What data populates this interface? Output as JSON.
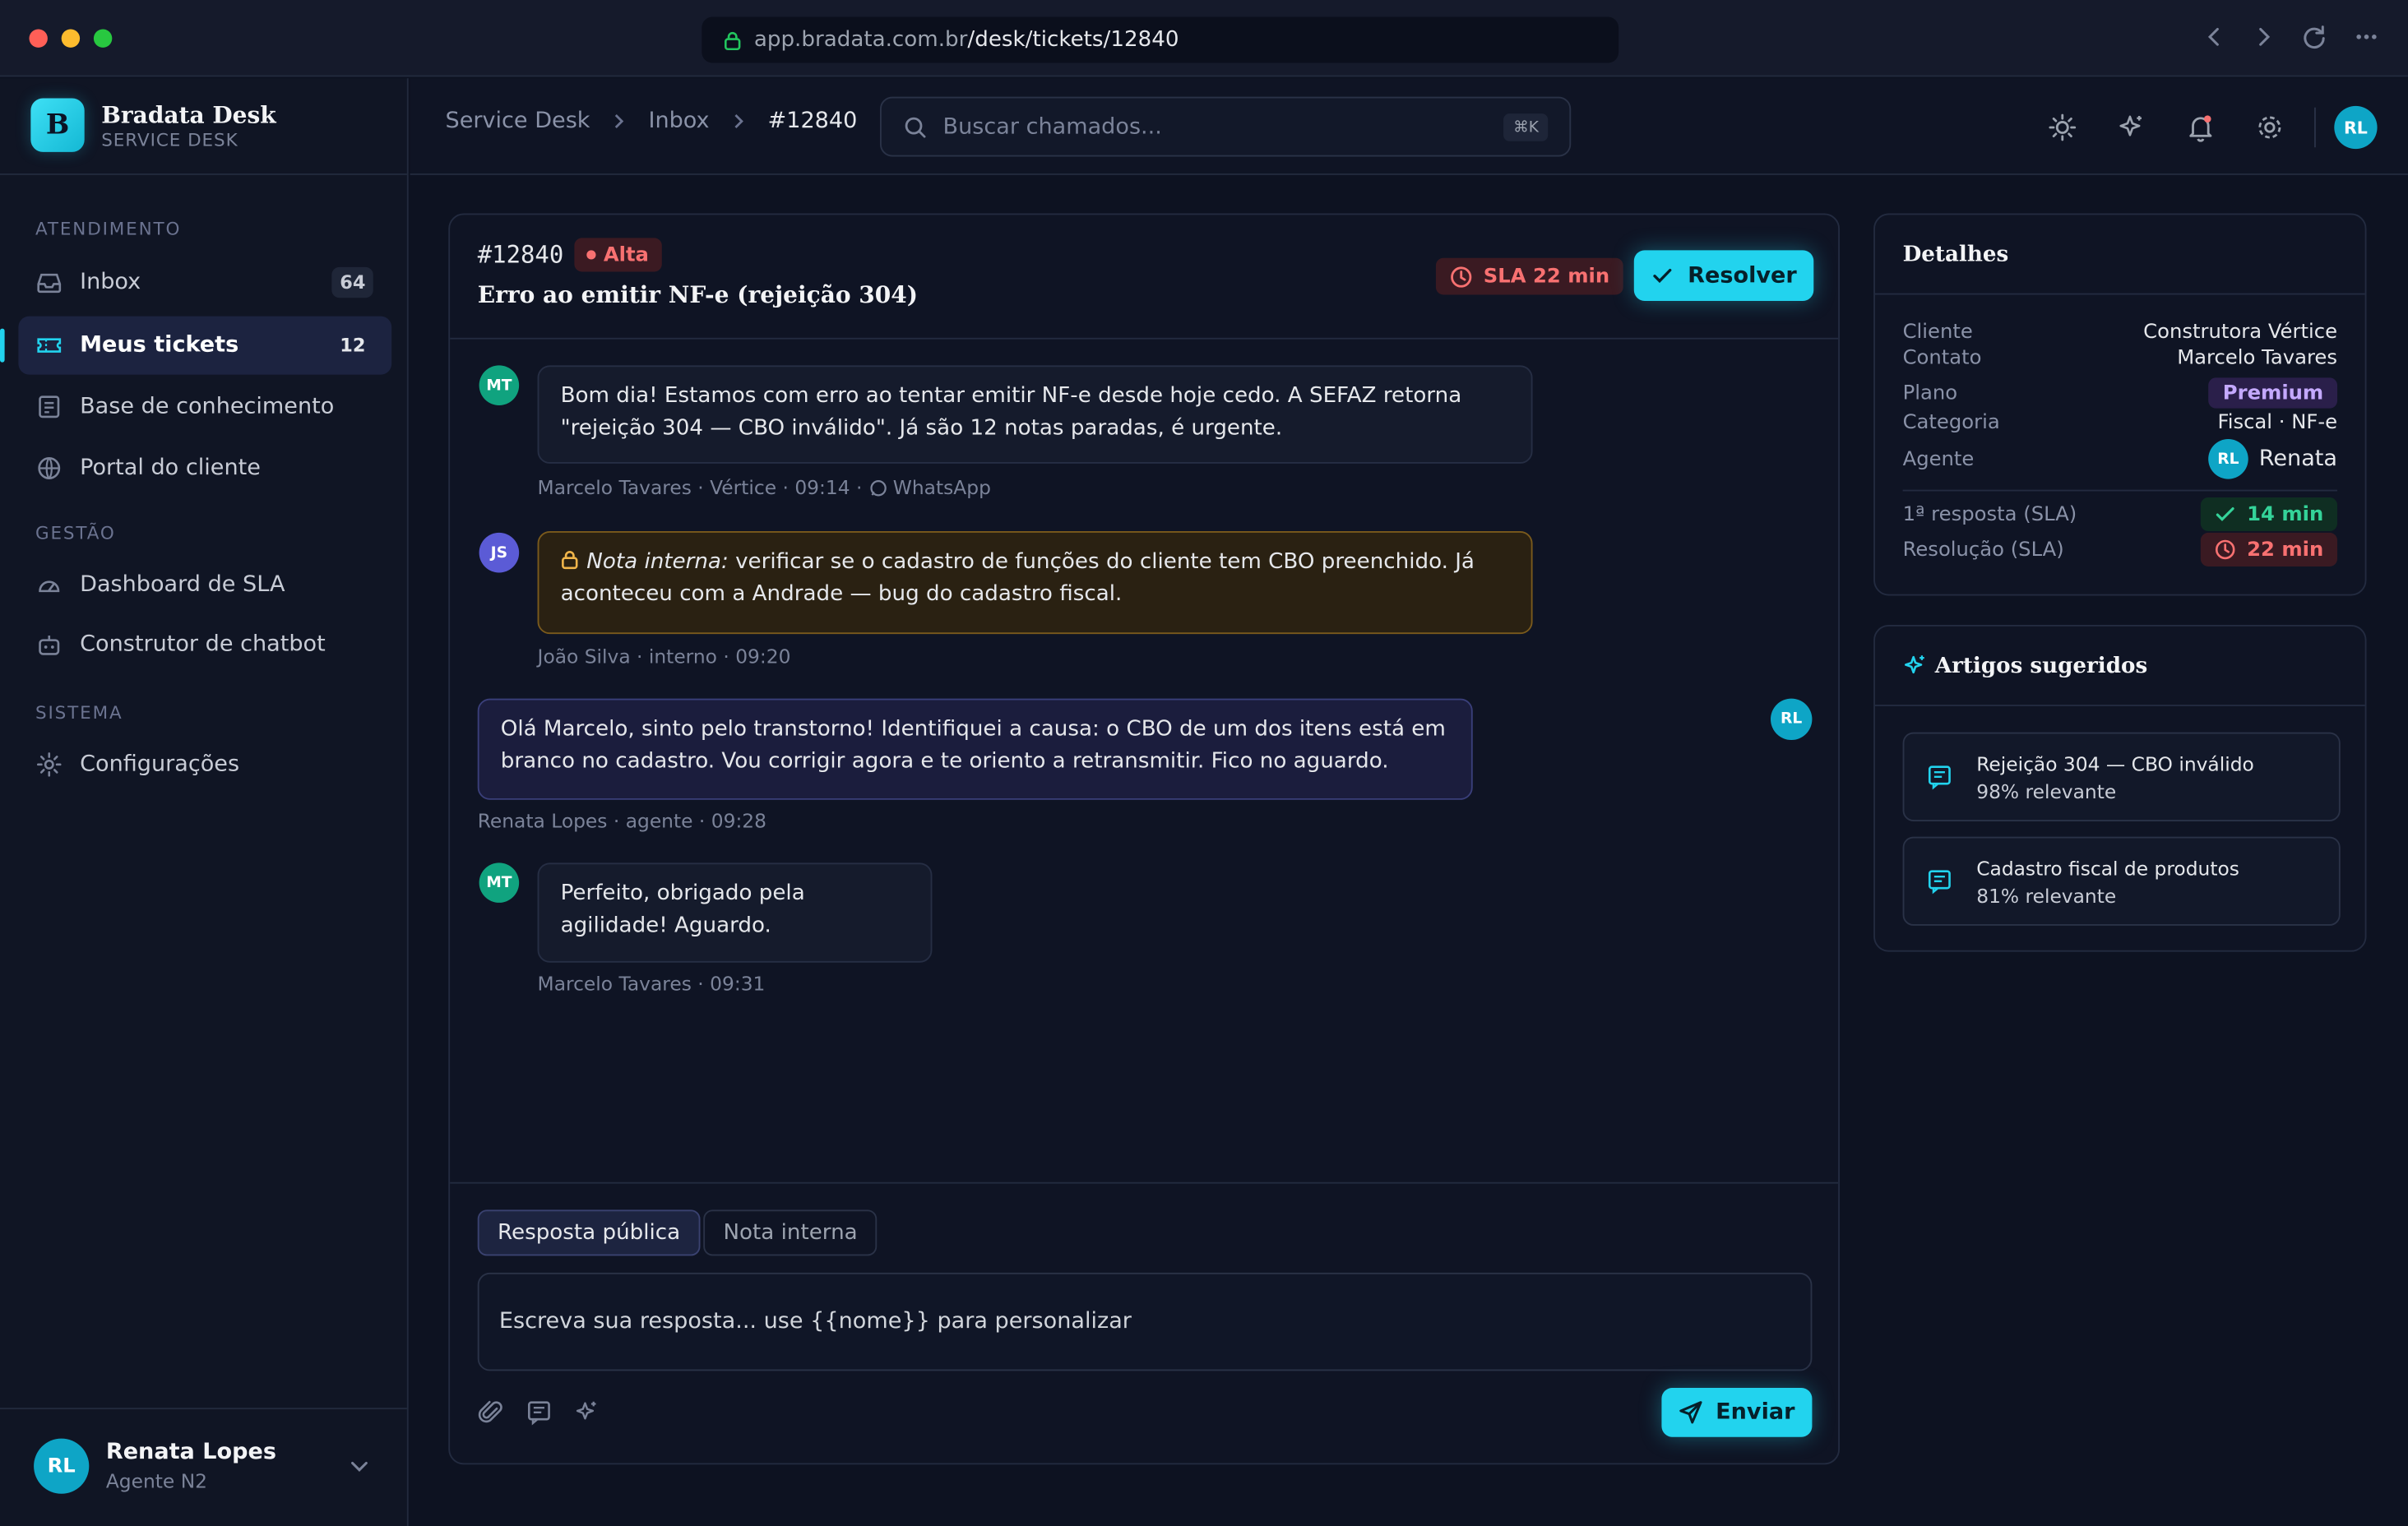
{
  "browser": {
    "url_host": "app.bradata.com.br",
    "url_path": "/desk/tickets/12840"
  },
  "brand": {
    "logo_letter": "B",
    "name": "Bradata Desk",
    "subtitle": "SERVICE DESK"
  },
  "sidebar": {
    "sections": {
      "atendimento": "ATENDIMENTO",
      "gestao": "GESTÃO",
      "sistema": "SISTEMA"
    },
    "items": [
      {
        "label": "Inbox",
        "count": "64",
        "icon": "inbox-icon"
      },
      {
        "label": "Meus tickets",
        "count": "12",
        "icon": "ticket-icon",
        "active": true
      },
      {
        "label": "Base de conhecimento",
        "icon": "book-icon"
      },
      {
        "label": "Portal do cliente",
        "icon": "globe-icon"
      },
      {
        "label": "Dashboard de SLA",
        "icon": "gauge-icon"
      },
      {
        "label": "Construtor de chatbot",
        "icon": "bot-icon"
      },
      {
        "label": "Configurações",
        "icon": "gear-icon"
      }
    ],
    "user": {
      "initials": "RL",
      "name": "Renata Lopes",
      "role": "Agente N2"
    }
  },
  "header": {
    "breadcrumbs": [
      "Service Desk",
      "Inbox",
      "#12840"
    ],
    "search_placeholder": "Buscar chamados...",
    "search_shortcut": "⌘K",
    "avatar_initials": "RL"
  },
  "ticket": {
    "id": "#12840",
    "priority": "Alta",
    "title": "Erro ao emitir NF-e (rejeição 304)",
    "sla_label": "SLA 22 min",
    "resolve_label": "Resolver",
    "messages": [
      {
        "initials": "MT",
        "text": "Bom dia! Estamos com erro ao tentar emitir NF-e desde hoje cedo. A SEFAZ retorna \"rejeição 304 — CBO inválido\". Já são 12 notas paradas, é urgente.",
        "meta": "Marcelo Tavares · Vértice · 09:14 ·",
        "channel": "WhatsApp"
      },
      {
        "initials": "JS",
        "note_label": "Nota interna:",
        "text": " verificar se o cadastro de funções do cliente tem CBO preenchido. Já aconteceu com a Andrade — bug do cadastro fiscal.",
        "meta": "João Silva · interno · 09:20"
      },
      {
        "initials": "RL",
        "text": "Olá Marcelo, sinto pelo transtorno! Identifiquei a causa: o CBO de um dos itens está em branco no cadastro. Vou corrigir agora e te oriento a retransmitir. Fico no aguardo.",
        "meta": "Renata Lopes · agente · 09:28"
      },
      {
        "initials": "MT",
        "text": "Perfeito, obrigado pela agilidade! Aguardo.",
        "meta": "Marcelo Tavares · 09:31"
      }
    ],
    "composer": {
      "tab_public": "Resposta pública",
      "tab_internal": "Nota interna",
      "placeholder": "Escreva sua resposta... use {{nome}} para personalizar",
      "send_label": "Enviar"
    }
  },
  "details": {
    "title": "Detalhes",
    "rows": {
      "cliente": {
        "key": "Cliente",
        "value": "Construtora Vértice"
      },
      "contato": {
        "key": "Contato",
        "value": "Marcelo Tavares"
      },
      "plano": {
        "key": "Plano",
        "value": "Premium"
      },
      "categoria": {
        "key": "Categoria",
        "value": "Fiscal · NF-e"
      },
      "agente": {
        "key": "Agente",
        "value": "Renata",
        "initials": "RL"
      },
      "first_response": {
        "key": "1ª resposta (SLA)",
        "value": "14 min"
      },
      "resolution": {
        "key": "Resolução (SLA)",
        "value": "22 min"
      }
    }
  },
  "articles": {
    "title": "Artigos sugeridos",
    "items": [
      {
        "title": "Rejeição 304 — CBO inválido",
        "relevance": "98% relevante"
      },
      {
        "title": "Cadastro fiscal de produtos",
        "relevance": "81% relevante"
      }
    ]
  },
  "colors": {
    "accent": "#22d3ee",
    "danger": "#f87171",
    "success": "#34d399",
    "premium": "#c4a9ff"
  }
}
